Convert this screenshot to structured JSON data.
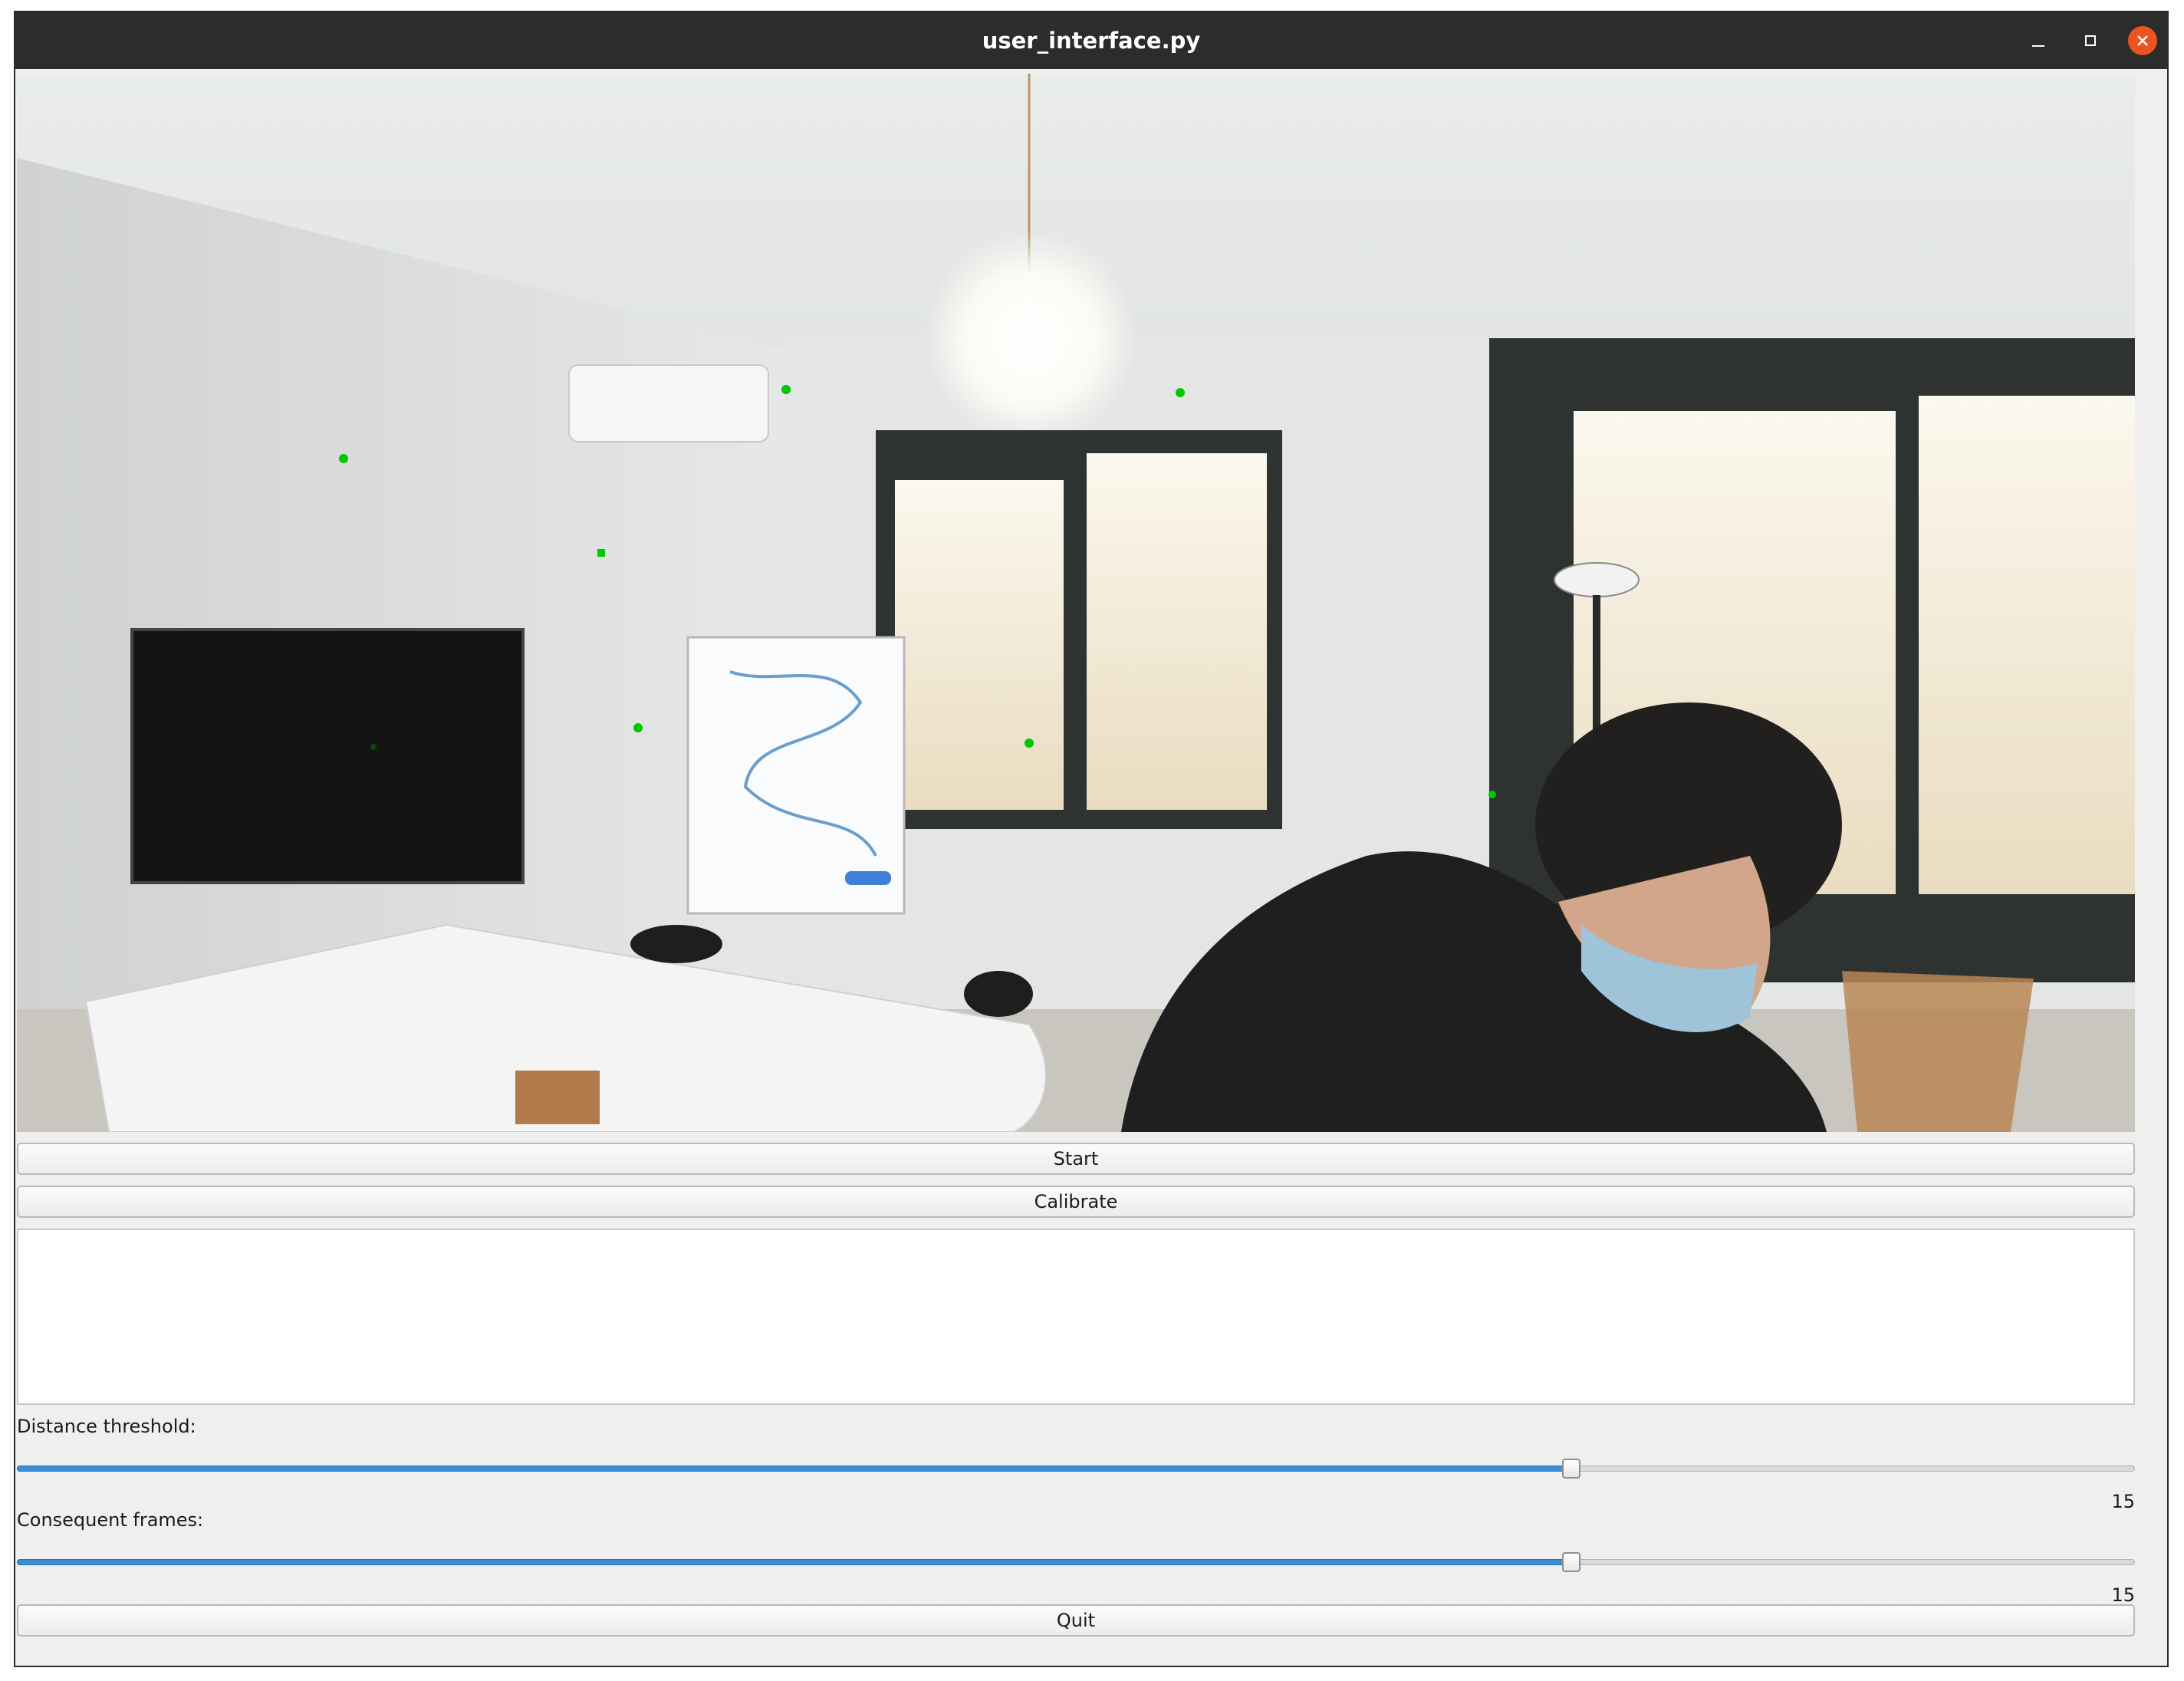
{
  "window": {
    "title": "user_interface.py",
    "controls": [
      "minimize-icon",
      "maximize-icon",
      "close-icon"
    ],
    "close_color": "#e95420"
  },
  "video_feed": {
    "description_markers": "green-tracking-dots",
    "marker_color": "#00c800"
  },
  "buttons": {
    "start": "Start",
    "calibrate": "Calibrate",
    "quit": "Quit"
  },
  "log": {
    "text": ""
  },
  "sliders": {
    "distance_threshold": {
      "label": "Distance threshold:",
      "value": "15",
      "fraction": 0.734
    },
    "consequent_frames": {
      "label": "Consequent frames:",
      "value": "15",
      "fraction": 0.734
    }
  },
  "colors": {
    "accent": "#3d8ed6",
    "titlebar": "#2c2c2c",
    "window_bg": "#efefef"
  }
}
